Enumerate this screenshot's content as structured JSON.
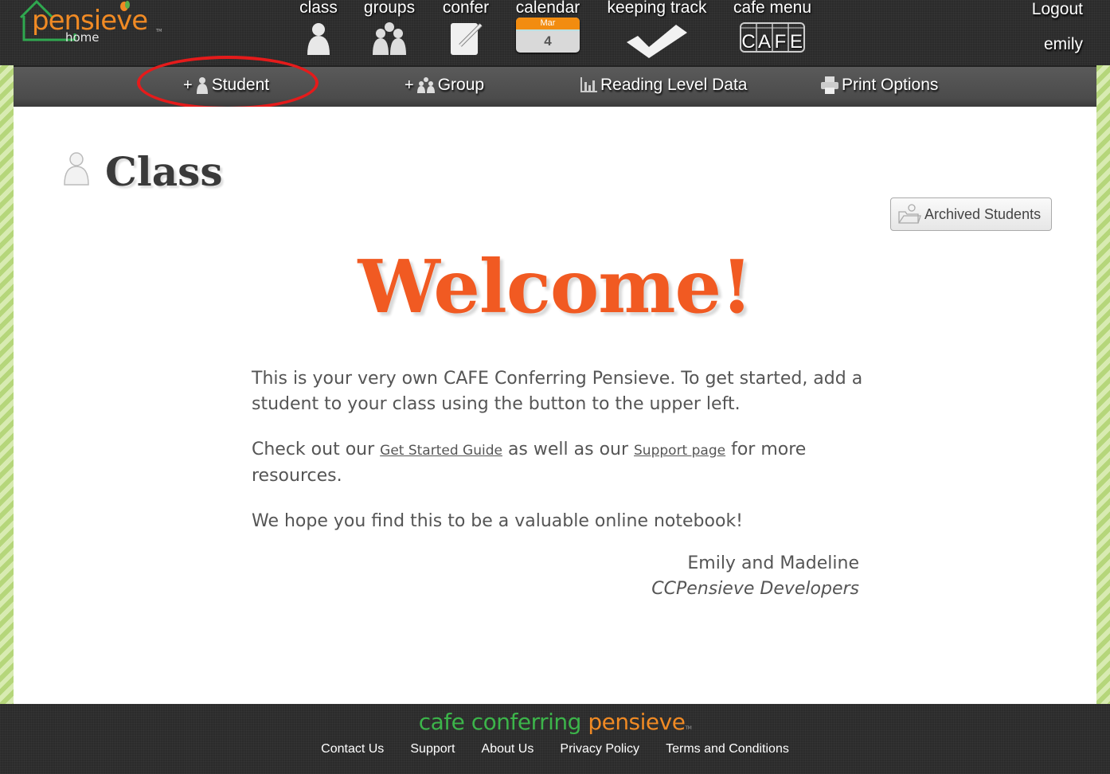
{
  "header": {
    "logo": {
      "word": "pensieve",
      "sub": "home",
      "tm": "TM"
    },
    "nav": [
      {
        "id": "class",
        "label": "class",
        "icon": "person-icon"
      },
      {
        "id": "groups",
        "label": "groups",
        "icon": "group-icon"
      },
      {
        "id": "confer",
        "label": "confer",
        "icon": "notepad-pencil-icon"
      },
      {
        "id": "calendar",
        "label": "calendar",
        "icon": "calendar-icon",
        "month": "Mar",
        "day": "4"
      },
      {
        "id": "keeping-track",
        "label": "keeping track",
        "icon": "checkmark-icon"
      },
      {
        "id": "cafe-menu",
        "label": "cafe menu",
        "icon": "cafe-sign-icon",
        "sign": [
          "C",
          "A",
          "F",
          "E"
        ]
      }
    ],
    "logout_label": "Logout",
    "username": "emily"
  },
  "subnav": {
    "items": [
      {
        "id": "add-student",
        "plus": "+",
        "label": "Student",
        "icon": "add-student-icon"
      },
      {
        "id": "add-group",
        "plus": "+",
        "label": "Group",
        "icon": "add-group-icon"
      },
      {
        "id": "reading-level",
        "label": "Reading Level Data",
        "icon": "bar-chart-icon"
      },
      {
        "id": "print-options",
        "label": "Print Options",
        "icon": "printer-icon"
      }
    ]
  },
  "main": {
    "title": "Class",
    "archived_button": "Archived Students",
    "welcome": "Welcome!",
    "para1": "This is your very own CAFE Conferring Pensieve. To get started, add a student to your class using the button to the upper left.",
    "para2": {
      "before": "Check out our ",
      "link1": "Get Started Guide",
      "middle": " as well as our ",
      "link2": "Support page",
      "after": " for more resources."
    },
    "para3": "We hope you find this to be a valuable online notebook!",
    "signature_name": "Emily and Madeline",
    "signature_role": "CCPensieve Developers"
  },
  "footer": {
    "logo_green": "cafe conferring ",
    "logo_orange": "pensieve",
    "logo_tm": "TM",
    "links": [
      "Contact Us",
      "Support",
      "About Us",
      "Privacy Policy",
      "Terms and Conditions"
    ]
  },
  "colors": {
    "accent_orange": "#f15a22",
    "brand_green": "#3cb44a",
    "header_bg": "#2b2b2b",
    "highlight_ring": "#e51b1b"
  }
}
